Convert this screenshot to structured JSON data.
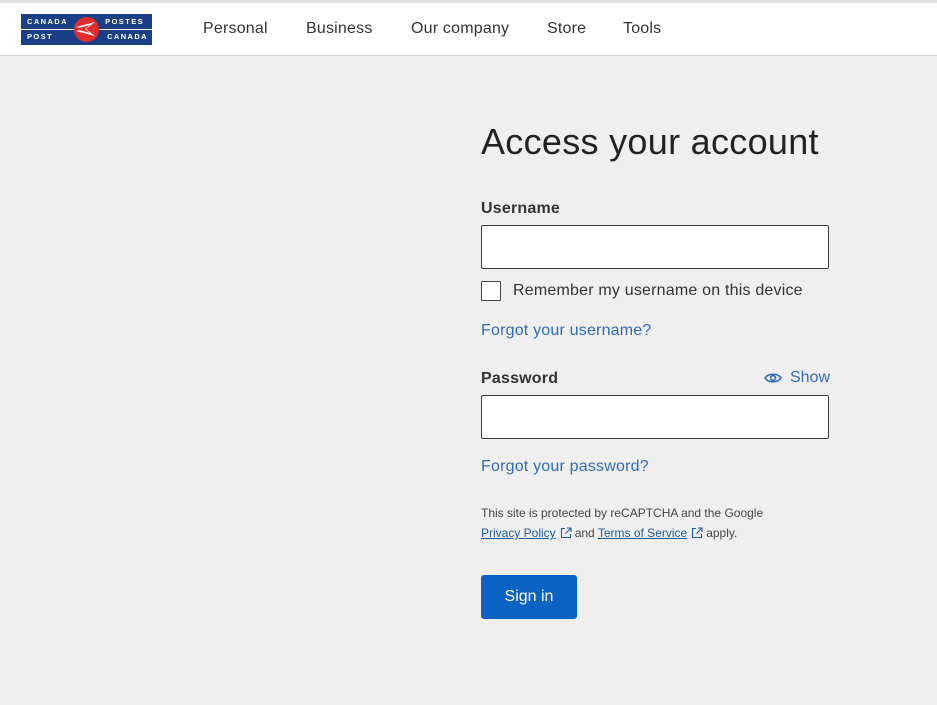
{
  "logo": {
    "line1_left": "CANADA",
    "line2_left": "POST",
    "line1_right": "POSTES",
    "line2_right": "CANADA"
  },
  "nav": [
    "Personal",
    "Business",
    "Our company",
    "Store",
    "Tools"
  ],
  "form": {
    "title": "Access your account",
    "username_label": "Username",
    "username_value": "",
    "remember_label": "Remember my username on this device",
    "remember_checked": false,
    "forgot_username": "Forgot your username?",
    "password_label": "Password",
    "password_value": "",
    "show_label": "Show",
    "forgot_password": "Forgot your password?",
    "recaptcha": {
      "line1": "This site is protected by reCAPTCHA and the Google",
      "privacy": "Privacy Policy",
      "and": "and",
      "terms": "Terms of Service",
      "apply": "apply."
    },
    "signin_label": "Sign in"
  },
  "colors": {
    "brand_blue": "#1b3f87",
    "brand_red": "#e32d2d",
    "link": "#2e6cba",
    "button": "#0b63c6",
    "background": "#efefef"
  },
  "icons": {
    "show": "eye-icon",
    "external": "external-link-icon"
  }
}
